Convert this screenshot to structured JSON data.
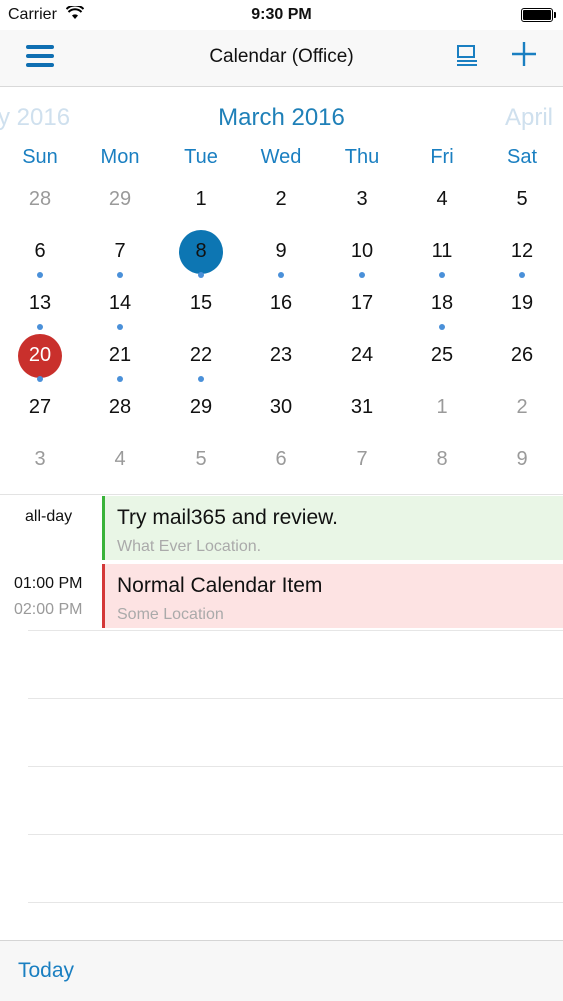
{
  "status_bar": {
    "carrier": "Carrier",
    "time": "9:30 PM"
  },
  "nav": {
    "title": "Calendar (Office)"
  },
  "month_header": {
    "prev": "ry 2016",
    "current": "March 2016",
    "next": "April"
  },
  "weekdays": [
    "Sun",
    "Mon",
    "Tue",
    "Wed",
    "Thu",
    "Fri",
    "Sat"
  ],
  "calendar": {
    "colors": {
      "selected": "#0d76b3",
      "today": "#c9302c",
      "event_dot": "#4a90d9"
    },
    "weeks": [
      [
        {
          "d": "28",
          "muted": true
        },
        {
          "d": "29",
          "muted": true
        },
        {
          "d": "1"
        },
        {
          "d": "2"
        },
        {
          "d": "3"
        },
        {
          "d": "4"
        },
        {
          "d": "5"
        }
      ],
      [
        {
          "d": "6",
          "dot": true
        },
        {
          "d": "7",
          "dot": true
        },
        {
          "d": "8",
          "selected": true,
          "dot": true
        },
        {
          "d": "9",
          "dot": true
        },
        {
          "d": "10",
          "dot": true
        },
        {
          "d": "11",
          "dot": true
        },
        {
          "d": "12",
          "dot": true
        }
      ],
      [
        {
          "d": "13",
          "dot": true
        },
        {
          "d": "14",
          "dot": true
        },
        {
          "d": "15"
        },
        {
          "d": "16"
        },
        {
          "d": "17"
        },
        {
          "d": "18",
          "dot": true
        },
        {
          "d": "19"
        }
      ],
      [
        {
          "d": "20",
          "today": true,
          "dot": true
        },
        {
          "d": "21",
          "dot": true
        },
        {
          "d": "22",
          "dot": true
        },
        {
          "d": "23"
        },
        {
          "d": "24"
        },
        {
          "d": "25"
        },
        {
          "d": "26"
        }
      ],
      [
        {
          "d": "27"
        },
        {
          "d": "28"
        },
        {
          "d": "29"
        },
        {
          "d": "30"
        },
        {
          "d": "31"
        },
        {
          "d": "1",
          "muted": true
        },
        {
          "d": "2",
          "muted": true
        }
      ],
      [
        {
          "d": "3",
          "muted": true
        },
        {
          "d": "4",
          "muted": true
        },
        {
          "d": "5",
          "muted": true
        },
        {
          "d": "6",
          "muted": true
        },
        {
          "d": "7",
          "muted": true
        },
        {
          "d": "8",
          "muted": true
        },
        {
          "d": "9",
          "muted": true
        }
      ]
    ]
  },
  "agenda": {
    "allday_label": "all-day",
    "allday_event": {
      "title": "Try mail365 and review.",
      "location": "What Ever Location.",
      "color": "#3ab33a"
    },
    "timed_event": {
      "start": "01:00 PM",
      "end": "02:00 PM",
      "title": "Normal Calendar Item",
      "location": "Some Location",
      "color": "#d43838"
    }
  },
  "toolbar": {
    "today_label": "Today"
  },
  "icons": {
    "menu": "hamburger-icon",
    "list": "list-view-icon",
    "add": "plus-icon",
    "wifi": "wifi-icon",
    "battery": "battery-icon"
  }
}
